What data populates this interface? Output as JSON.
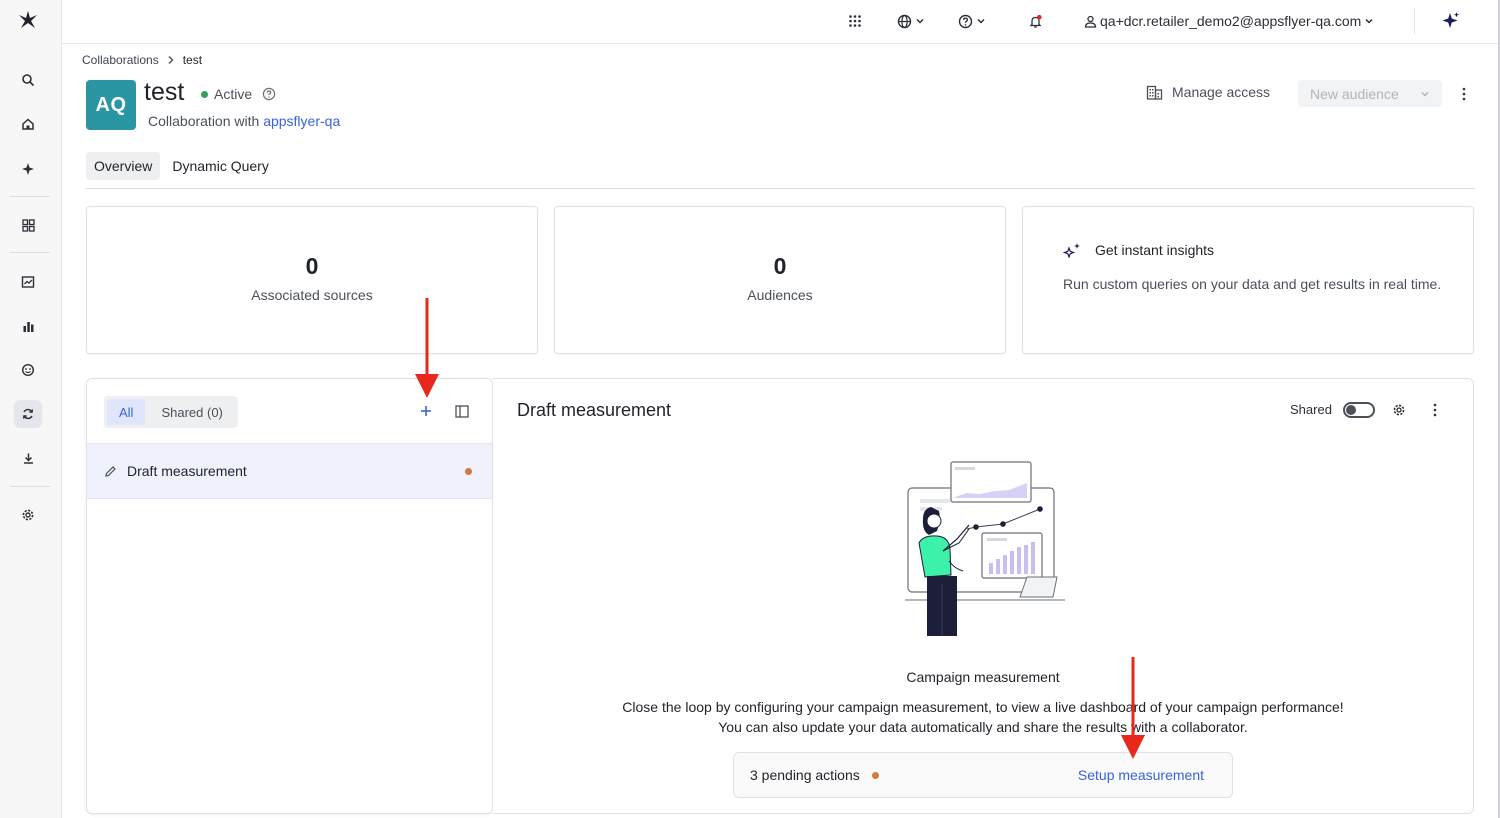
{
  "topbar": {
    "user_email": "qa+dcr.retailer_demo2@appsflyer-qa.com"
  },
  "breadcrumb": {
    "parent": "Collaborations",
    "current": "test"
  },
  "header": {
    "avatar_initials": "AQ",
    "title": "test",
    "status": "Active",
    "subtitle_prefix": "Collaboration with",
    "partner": "appsflyer-qa",
    "manage_access": "Manage access",
    "new_audience": "New audience"
  },
  "tabs": [
    {
      "label": "Overview",
      "selected": true
    },
    {
      "label": "Dynamic Query",
      "selected": false
    }
  ],
  "cards": {
    "sources": {
      "value": "0",
      "label": "Associated sources"
    },
    "audiences": {
      "value": "0",
      "label": "Audiences"
    },
    "insights": {
      "title": "Get instant insights",
      "text": "Run custom queries on your data and get results in real time."
    }
  },
  "list_panel": {
    "filter_all": "All",
    "filter_shared": "Shared (0)",
    "items": [
      {
        "label": "Draft measurement"
      }
    ]
  },
  "detail": {
    "title": "Draft measurement",
    "shared_label": "Shared",
    "shared_on": false,
    "empty_title": "Campaign measurement",
    "empty_text_1": "Close the loop by configuring your campaign measurement, to view a live dashboard of your campaign performance!",
    "empty_text_2": "You can also update your data automatically and share the results with a collaborator.",
    "pending_label": "3 pending actions",
    "setup_link": "Setup measurement"
  },
  "colors": {
    "accent": "#3a63d6",
    "avatar": "#2b96a3",
    "active_dot": "#2fa35a",
    "pending_dot": "#d27a3a",
    "annotation_arrow": "#e8281e"
  },
  "icons": [
    "logo-icon",
    "search-icon",
    "home-icon",
    "sparkle-icon",
    "grid-icon",
    "report-icon",
    "chart-icon",
    "face-icon",
    "sync-icon",
    "download-icon",
    "gear-icon",
    "apps-icon",
    "globe-icon",
    "help-icon",
    "bell-icon",
    "user-icon",
    "ai-star-icon"
  ]
}
